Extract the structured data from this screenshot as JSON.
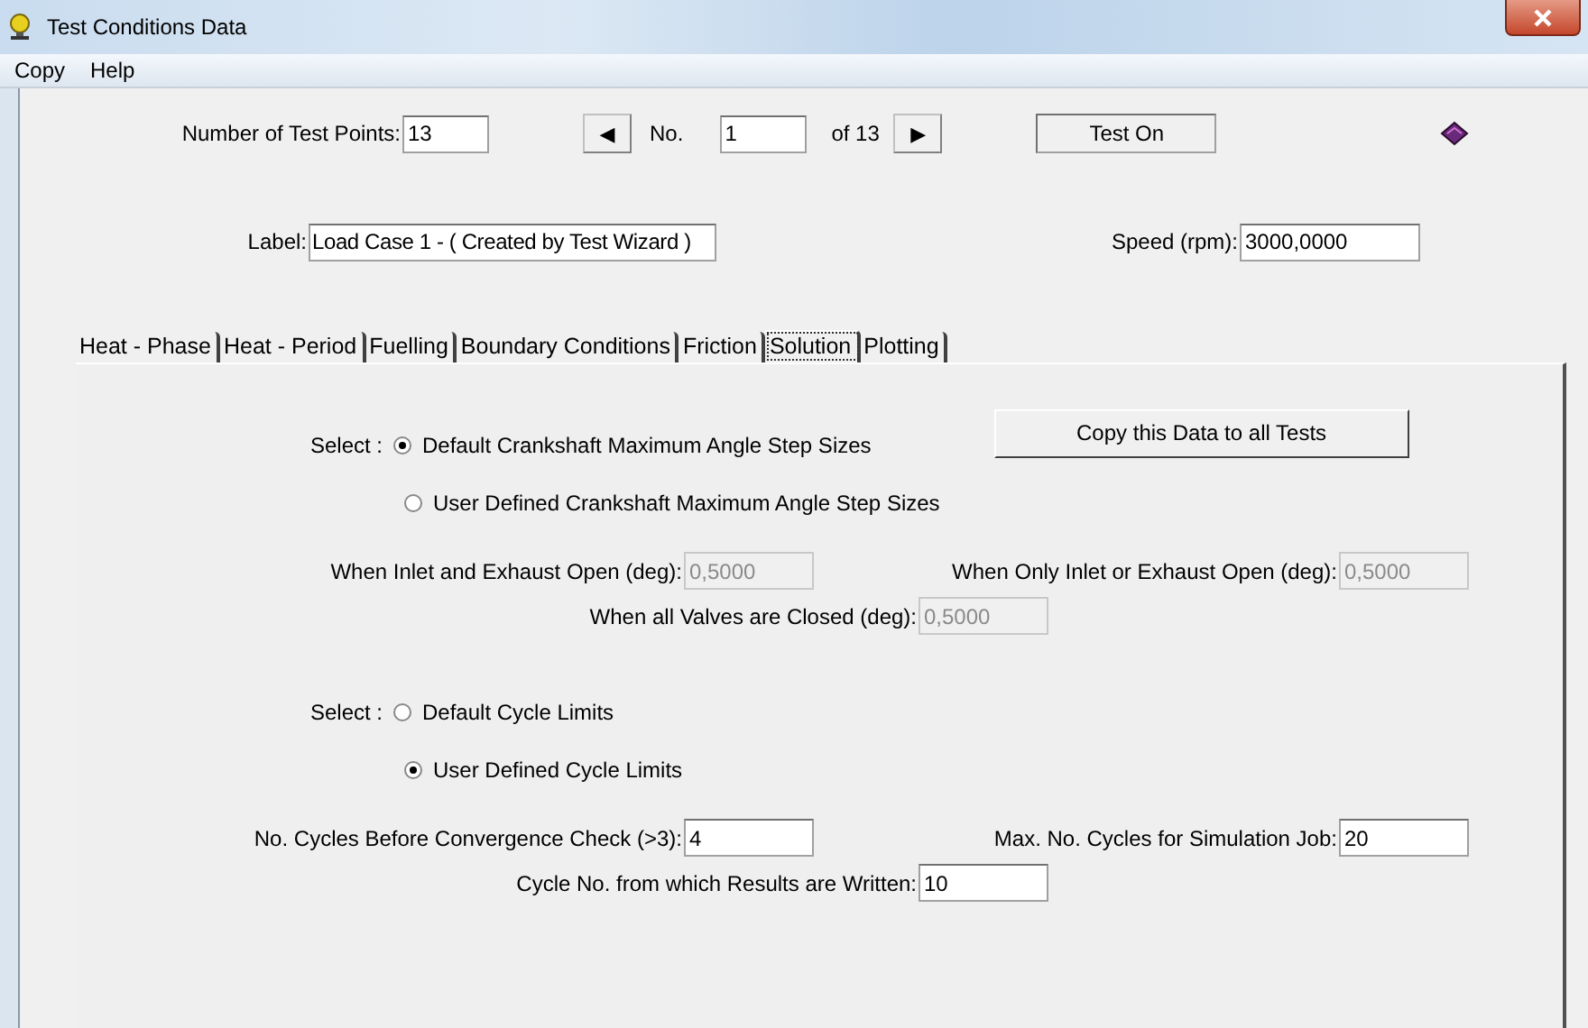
{
  "window": {
    "title": "Test Conditions Data"
  },
  "menu": [
    "Copy",
    "Help"
  ],
  "header": {
    "test_points": {
      "label": "Number of Test Points:",
      "value": "13"
    },
    "nav": {
      "prev": "◀",
      "no_label": "No.",
      "no_value": "1",
      "of_label": "of 13",
      "next": "▶"
    },
    "status": "Test On",
    "label_field": {
      "label": "Label:",
      "value": "Load Case 1 - ( Created by Test Wizard )"
    },
    "speed_field": {
      "label": "Speed (rpm):",
      "value": "3000,0000"
    }
  },
  "tabs": [
    {
      "label": "Heat - Phase",
      "selected": false
    },
    {
      "label": "Heat - Period",
      "selected": false
    },
    {
      "label": "Fuelling",
      "selected": false
    },
    {
      "label": "Boundary Conditions",
      "selected": false
    },
    {
      "label": "Friction",
      "selected": false
    },
    {
      "label": "Solution",
      "selected": true
    },
    {
      "label": "Plotting",
      "selected": false
    }
  ],
  "panel": {
    "copy_button": "Copy this Data to all Tests",
    "groups": [
      {
        "select_label": "Select :",
        "options": [
          {
            "label": "Default Crankshaft Maximum Angle Step Sizes",
            "selected": true
          },
          {
            "label": "User Defined Crankshaft Maximum Angle Step Sizes",
            "selected": false
          }
        ],
        "fields": [
          {
            "label": "When Inlet and Exhaust Open (deg):",
            "value": "0,5000",
            "disabled": true
          },
          {
            "label": "When Only Inlet or Exhaust Open (deg):",
            "value": "0,5000",
            "disabled": true
          },
          {
            "label": "When all Valves are Closed (deg):",
            "value": "0,5000",
            "disabled": true
          }
        ]
      },
      {
        "select_label": "Select :",
        "options": [
          {
            "label": "Default Cycle Limits",
            "selected": false
          },
          {
            "label": "User Defined Cycle Limits",
            "selected": true
          }
        ],
        "fields": [
          {
            "label": "No. Cycles Before Convergence Check (>3):",
            "value": "4",
            "disabled": false
          },
          {
            "label": "Max. No. Cycles for Simulation Job:",
            "value": "20",
            "disabled": false
          },
          {
            "label": "Cycle No. from which Results are Written:",
            "value": "10",
            "disabled": false
          }
        ]
      }
    ]
  }
}
